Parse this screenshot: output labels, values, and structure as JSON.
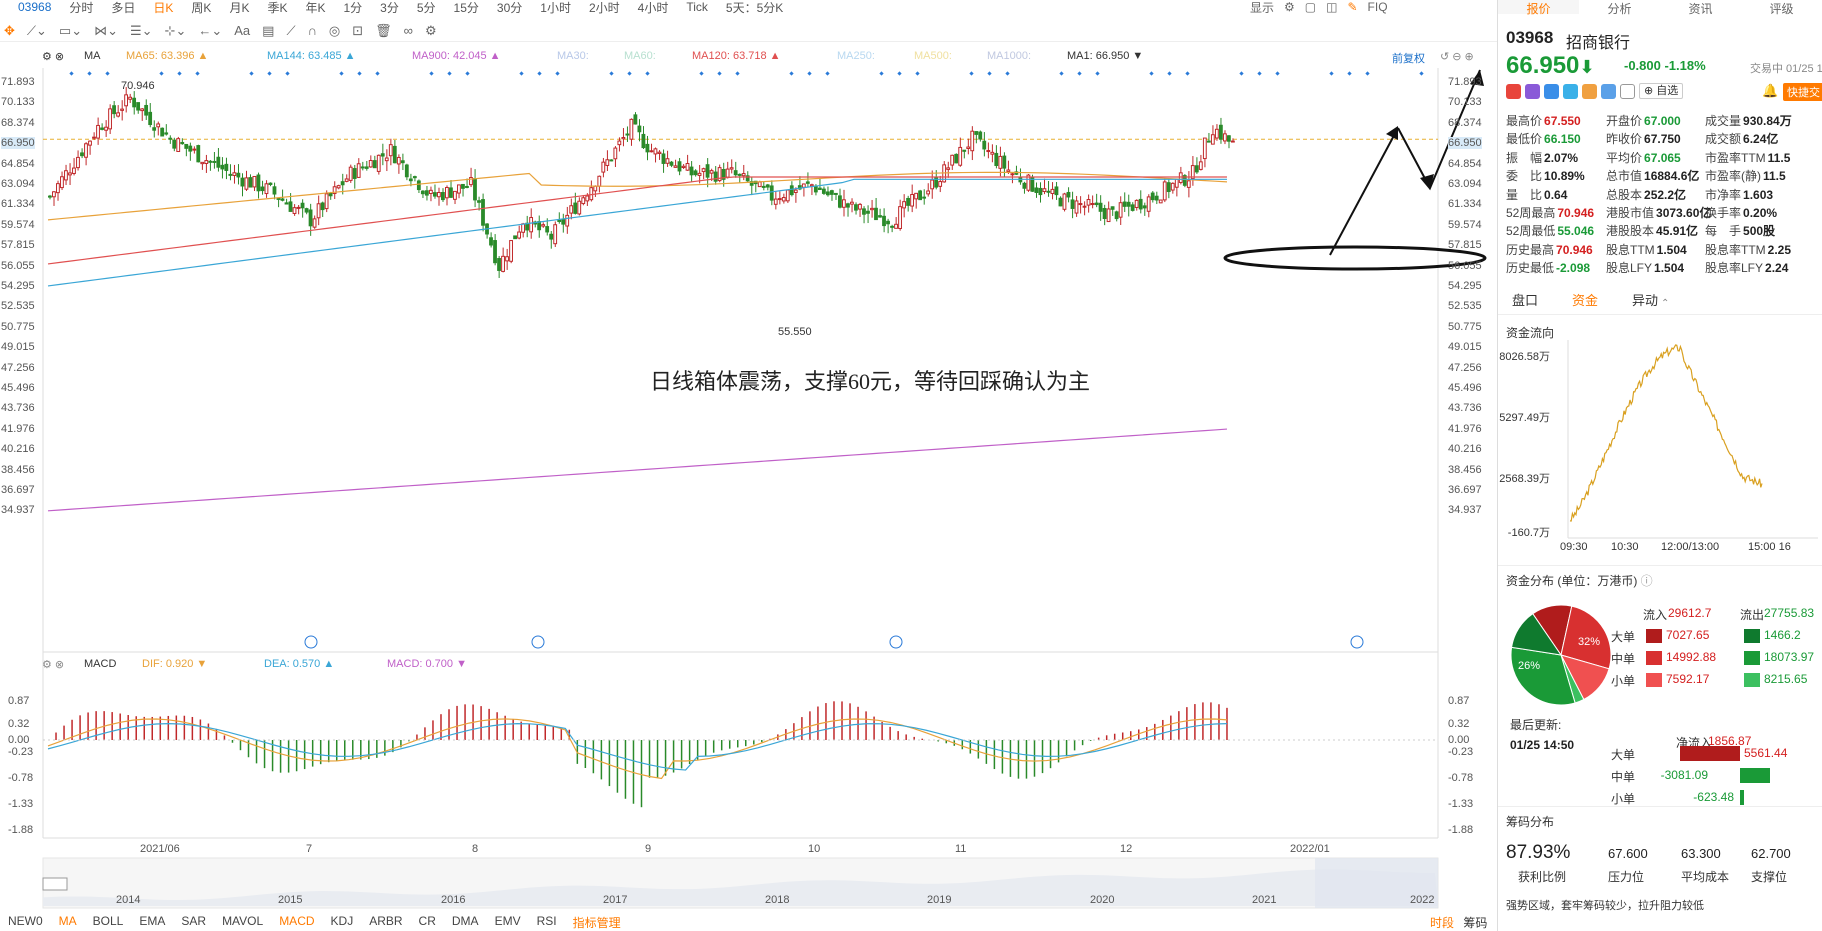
{
  "toolbar": {
    "code": "03968",
    "periods": [
      "分时",
      "多日",
      "日K",
      "周K",
      "月K",
      "季K",
      "年K",
      "1分",
      "3分",
      "5分",
      "15分",
      "30分",
      "1小时",
      "2小时",
      "4小时",
      "Tick",
      "5天：5分K"
    ],
    "active_period": "日K",
    "right_items": [
      "显示",
      "FIQ"
    ]
  },
  "ma_bar": {
    "ma_label": "MA",
    "items": [
      {
        "text": "MA65: 63.396 ▲",
        "color": "#e8a23a"
      },
      {
        "text": "MA144: 63.485 ▲",
        "color": "#3aa6d6"
      },
      {
        "text": "MA900: 42.045 ▲",
        "color": "#c060c8"
      },
      {
        "text": "MA30:",
        "color": "#b8c8e8"
      },
      {
        "text": "MA60:",
        "color": "#b8e0d0"
      },
      {
        "text": "MA120: 63.718 ▲",
        "color": "#e05050"
      },
      {
        "text": "MA250:",
        "color": "#b8d8f0"
      },
      {
        "text": "MA500:",
        "color": "#f0e0a0"
      },
      {
        "text": "MA1000:",
        "color": "#c0c8e0"
      },
      {
        "text": "MA1: 66.950 ▼",
        "color": "#333333"
      }
    ],
    "fq": "前复权"
  },
  "price_axis": [
    "71.893",
    "70.133",
    "68.374",
    "66.950",
    "64.854",
    "63.094",
    "61.334",
    "59.574",
    "57.815",
    "56.055",
    "54.295",
    "52.535",
    "50.775",
    "49.015",
    "47.256",
    "45.496",
    "43.736",
    "41.976",
    "40.216",
    "38.456",
    "36.697",
    "34.937"
  ],
  "high_label": "70.946",
  "low_label": "55.550",
  "annotation": "日线箱体震荡，支撑60元，等待回踩确认为主",
  "macd_bar": {
    "label": "MACD",
    "dif": "DIF: 0.920 ▼",
    "dea": "DEA: 0.570 ▲",
    "macd": "MACD: 0.700 ▼"
  },
  "macd_axis": [
    "0.87",
    "0.32",
    "0.00",
    "-0.23",
    "-0.78",
    "-1.33",
    "-1.88"
  ],
  "macd_axis_right": [
    "0.87",
    "0.32",
    "0.00",
    "-0.23",
    "-0.78",
    "-1.33",
    "-1.88"
  ],
  "date_axis": [
    "2021/06",
    "7",
    "8",
    "9",
    "10",
    "11",
    "12",
    "2022/01"
  ],
  "year_axis": [
    "2014",
    "2015",
    "2016",
    "2017",
    "2018",
    "2019",
    "2020",
    "2021",
    "2022"
  ],
  "indicators": [
    "NEW0",
    "MA",
    "BOLL",
    "EMA",
    "SAR",
    "MAVOL",
    "MACD",
    "KDJ",
    "ARBR",
    "CR",
    "DMA",
    "EMV",
    "RSI",
    "指标管理"
  ],
  "active_indicator": "MACD",
  "bottom_right": [
    "时段",
    "筹码"
  ],
  "right_panel": {
    "tabs": [
      "报价",
      "分析",
      "资讯",
      "评级"
    ],
    "code": "03968",
    "name": "招商银行",
    "price": "66.950",
    "change": "-0.800  -1.18%",
    "trade_time": "交易中 01/25 1",
    "zixuan": "自选",
    "kuaijie": "快捷交",
    "quotes": [
      [
        [
          "最高价",
          "67.550",
          "red"
        ],
        [
          "开盘价",
          "67.000",
          "green"
        ],
        [
          "成交量",
          "930.84万",
          "blk"
        ]
      ],
      [
        [
          "最低价",
          "66.150",
          "green"
        ],
        [
          "昨收价",
          "67.750",
          "blk"
        ],
        [
          "成交额",
          "6.24亿",
          "blk"
        ]
      ],
      [
        [
          "振　幅",
          "2.07%",
          "blk"
        ],
        [
          "平均价",
          "67.065",
          "green"
        ],
        [
          "市盈率TTM",
          "11.5",
          "blk"
        ]
      ],
      [
        [
          "委　比",
          "10.89%",
          "blk"
        ],
        [
          "总市值",
          "16884.6亿",
          "blk"
        ],
        [
          "市盈率(静)",
          "11.5",
          "blk"
        ]
      ],
      [
        [
          "量　比",
          "0.64",
          "blk"
        ],
        [
          "总股本",
          "252.2亿",
          "blk"
        ],
        [
          "市净率",
          "1.603",
          "blk"
        ]
      ],
      [
        [
          "52周最高",
          "70.946",
          "red"
        ],
        [
          "港股市值",
          "3073.60亿",
          "blk"
        ],
        [
          "换手率",
          "0.20%",
          "blk"
        ]
      ],
      [
        [
          "52周最低",
          "55.046",
          "green"
        ],
        [
          "港股股本",
          "45.91亿",
          "blk"
        ],
        [
          "每　手",
          "500股",
          "blk"
        ]
      ],
      [
        [
          "历史最高",
          "70.946",
          "red"
        ],
        [
          "股息TTM",
          "1.504",
          "blk"
        ],
        [
          "股息率TTM",
          "2.25",
          "blk"
        ]
      ],
      [
        [
          "历史最低",
          "-2.098",
          "green"
        ],
        [
          "股息LFY",
          "1.504",
          "blk"
        ],
        [
          "股息率LFY",
          "2.24",
          "blk"
        ]
      ]
    ],
    "subtabs": [
      "盘口",
      "资金",
      "异动"
    ],
    "active_subtab": "资金",
    "flow_title": "资金流向",
    "flow_y": [
      "8026.58万",
      "5297.49万",
      "2568.39万",
      "-160.7万"
    ],
    "flow_x": [
      "09:30",
      "10:30",
      "12:00/13:00",
      "15:00 16"
    ],
    "dist_title": "资金分布 (单位：万港币)",
    "pie_labels": [
      "32%",
      "26%"
    ],
    "inflow_label": "流入",
    "inflow_total": "29612.7",
    "outflow_label": "流出",
    "outflow_total": "27755.83",
    "rows": [
      {
        "name": "大单",
        "in": "7027.65",
        "out": "1466.2"
      },
      {
        "name": "中单",
        "in": "14992.88",
        "out": "18073.97"
      },
      {
        "name": "小单",
        "in": "7592.17",
        "out": "8215.65"
      }
    ],
    "last_update_label": "最后更新:",
    "last_update": "01/25 14:50",
    "net_label": "净流入",
    "net_total": "1856.87",
    "net_rows": [
      {
        "name": "大单",
        "val": "5561.44"
      },
      {
        "name": "中单",
        "val": "-3081.09"
      },
      {
        "name": "小单",
        "val": "-623.48"
      }
    ],
    "chip_title": "筹码分布",
    "chip_vals": [
      "87.93%",
      "67.600",
      "63.300",
      "62.700"
    ],
    "chip_labels": [
      "获利比例",
      "压力位",
      "平均成本",
      "支撑位"
    ],
    "chip_note": "强势区域，套牢筹码较少，拉升阻力较低"
  }
}
